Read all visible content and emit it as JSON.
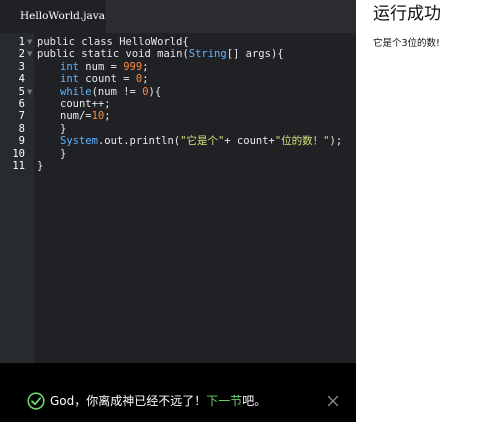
{
  "editor": {
    "tab_name": "HelloWorld.java",
    "line_numbers": [
      "1",
      "2",
      "3",
      "4",
      "5",
      "6",
      "7",
      "8",
      "9",
      "10",
      "11"
    ],
    "code": {
      "l1_kw1": "public",
      "l1_kw2": "class",
      "l1_name": "HelloWorld{",
      "l2_kw1": "public",
      "l2_kw2": "static",
      "l2_kw3": "void",
      "l2_fn": "main(",
      "l2_type": "String",
      "l2_rest": "[] args){",
      "l3_type": "int",
      "l3_mid": "num =",
      "l3_num": "999",
      "l3_end": ";",
      "l4_type": "int",
      "l4_mid": "count =",
      "l4_num": "0",
      "l4_end": ";",
      "l5_kw": "while",
      "l5_mid": "(num !=",
      "l5_num": "0",
      "l5_end": "){",
      "l6": "count++;",
      "l7_mid": "num/=",
      "l7_num": "10",
      "l7_end": ";",
      "l8": "}",
      "l9_type": "System",
      "l9_mid": ".out.println(",
      "l9_str1": "\"它是个\"",
      "l9_mid2": "+ count+",
      "l9_str2": "\"位的数！\"",
      "l9_end": ");",
      "l10": "}",
      "l11": "}"
    }
  },
  "toast": {
    "message": "God，你离成神已经不远了！",
    "link": "下一节",
    "suffix": "吧。"
  },
  "output": {
    "title": "运行成功",
    "text": "它是个3位的数!"
  },
  "colors": {
    "editor_bg": "#1f2125",
    "gutter_bg": "#272a2e",
    "toast_bg": "#000000",
    "success_green": "#6bd46a",
    "number": "#ff8b3d",
    "type": "#5fb4ff",
    "string": "#d3e17a"
  }
}
